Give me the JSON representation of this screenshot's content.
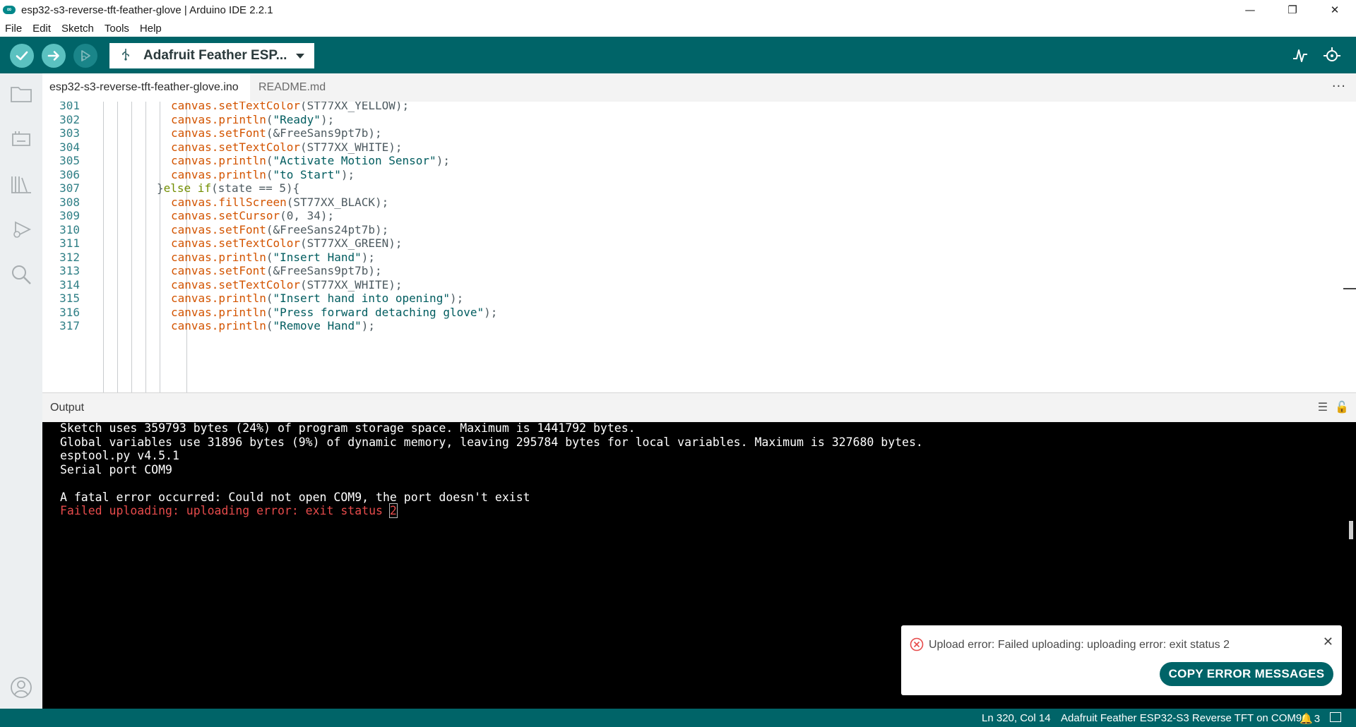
{
  "window": {
    "title": "esp32-s3-reverse-tft-feather-glove | Arduino IDE 2.2.1",
    "logo_text": "∞",
    "controls": [
      "—",
      "❐",
      "✕"
    ]
  },
  "menu": [
    "File",
    "Edit",
    "Sketch",
    "Tools",
    "Help"
  ],
  "toolbar": {
    "board": "Adafruit Feather ESP...",
    "accent": "#006468",
    "button_color": "#5bc1c0"
  },
  "tabs": [
    {
      "label": "esp32-s3-reverse-tft-feather-glove.ino",
      "active": true
    },
    {
      "label": "README.md",
      "active": false
    }
  ],
  "tab_more": "···",
  "editor": {
    "lines": [
      {
        "num": "301",
        "indent": 2,
        "parts": [
          [
            "fn",
            "canvas.setTextColor"
          ],
          [
            "plain",
            "(ST77XX_YELLOW);"
          ]
        ]
      },
      {
        "num": "302",
        "indent": 2,
        "parts": [
          [
            "fn",
            "canvas.println"
          ],
          [
            "plain",
            "("
          ],
          [
            "str",
            "\"Ready\""
          ],
          [
            "plain",
            ");"
          ]
        ]
      },
      {
        "num": "303",
        "indent": 2,
        "parts": [
          [
            "fn",
            "canvas.setFont"
          ],
          [
            "plain",
            "(&FreeSans9pt7b);"
          ]
        ]
      },
      {
        "num": "304",
        "indent": 2,
        "parts": [
          [
            "fn",
            "canvas.setTextColor"
          ],
          [
            "plain",
            "(ST77XX_WHITE);"
          ]
        ]
      },
      {
        "num": "305",
        "indent": 2,
        "parts": [
          [
            "fn",
            "canvas.println"
          ],
          [
            "plain",
            "("
          ],
          [
            "str",
            "\"Activate Motion Sensor\""
          ],
          [
            "plain",
            ");"
          ]
        ]
      },
      {
        "num": "306",
        "indent": 2,
        "parts": [
          [
            "fn",
            "canvas.println"
          ],
          [
            "plain",
            "("
          ],
          [
            "str",
            "\"to Start\""
          ],
          [
            "plain",
            ");"
          ]
        ]
      },
      {
        "num": "307",
        "indent": 1,
        "parts": [
          [
            "plain",
            "}"
          ],
          [
            "ctl",
            "else if"
          ],
          [
            "plain",
            "(state == 5){"
          ]
        ]
      },
      {
        "num": "308",
        "indent": 2,
        "parts": [
          [
            "fn",
            "canvas.fillScreen"
          ],
          [
            "plain",
            "(ST77XX_BLACK);"
          ]
        ]
      },
      {
        "num": "309",
        "indent": 2,
        "parts": [
          [
            "fn",
            "canvas.setCursor"
          ],
          [
            "plain",
            "(0, 34);"
          ]
        ]
      },
      {
        "num": "310",
        "indent": 2,
        "parts": [
          [
            "fn",
            "canvas.setFont"
          ],
          [
            "plain",
            "(&FreeSans24pt7b);"
          ]
        ]
      },
      {
        "num": "311",
        "indent": 2,
        "parts": [
          [
            "fn",
            "canvas.setTextColor"
          ],
          [
            "plain",
            "(ST77XX_GREEN);"
          ]
        ]
      },
      {
        "num": "312",
        "indent": 2,
        "parts": [
          [
            "fn",
            "canvas.println"
          ],
          [
            "plain",
            "("
          ],
          [
            "str",
            "\"Insert Hand\""
          ],
          [
            "plain",
            ");"
          ]
        ]
      },
      {
        "num": "313",
        "indent": 2,
        "parts": [
          [
            "fn",
            "canvas.setFont"
          ],
          [
            "plain",
            "(&FreeSans9pt7b);"
          ]
        ]
      },
      {
        "num": "314",
        "indent": 2,
        "parts": [
          [
            "fn",
            "canvas.setTextColor"
          ],
          [
            "plain",
            "(ST77XX_WHITE);"
          ]
        ]
      },
      {
        "num": "315",
        "indent": 2,
        "parts": [
          [
            "fn",
            "canvas.println"
          ],
          [
            "plain",
            "("
          ],
          [
            "str",
            "\"Insert hand into opening\""
          ],
          [
            "plain",
            ");"
          ]
        ]
      },
      {
        "num": "316",
        "indent": 2,
        "parts": [
          [
            "fn",
            "canvas.println"
          ],
          [
            "plain",
            "("
          ],
          [
            "str",
            "\"Press forward detaching glove\""
          ],
          [
            "plain",
            ");"
          ]
        ]
      },
      {
        "num": "317",
        "indent": 2,
        "parts": [
          [
            "fn",
            "canvas.println"
          ],
          [
            "plain",
            "("
          ],
          [
            "str",
            "\"Remove Hand\""
          ],
          [
            "plain",
            ");"
          ]
        ]
      }
    ]
  },
  "output": {
    "title": "Output",
    "tools": [
      "☰",
      "🔓"
    ],
    "lines": [
      {
        "text": "Sketch uses 359793 bytes (24%) of program storage space. Maximum is 1441792 bytes.",
        "error": false
      },
      {
        "text": "Global variables use 31896 bytes (9%) of dynamic memory, leaving 295784 bytes for local variables. Maximum is 327680 bytes.",
        "error": false
      },
      {
        "text": "esptool.py v4.5.1",
        "error": false
      },
      {
        "text": "Serial port COM9",
        "error": false
      },
      {
        "text": "",
        "error": false
      },
      {
        "text": "A fatal error occurred: Could not open COM9, the port doesn't exist",
        "error": false
      },
      {
        "text": "Failed uploading: uploading error: exit status ",
        "error": true,
        "tail": "2"
      }
    ]
  },
  "notification": {
    "message": "Upload error: Failed uploading: uploading error: exit status 2",
    "button": "COPY ERROR MESSAGES",
    "close": "✕",
    "error_color": "#e64b4b"
  },
  "statusbar": {
    "position": "Ln 320, Col 14",
    "board": "Adafruit Feather ESP32-S3 Reverse TFT on COM9",
    "notification_count": "3"
  }
}
